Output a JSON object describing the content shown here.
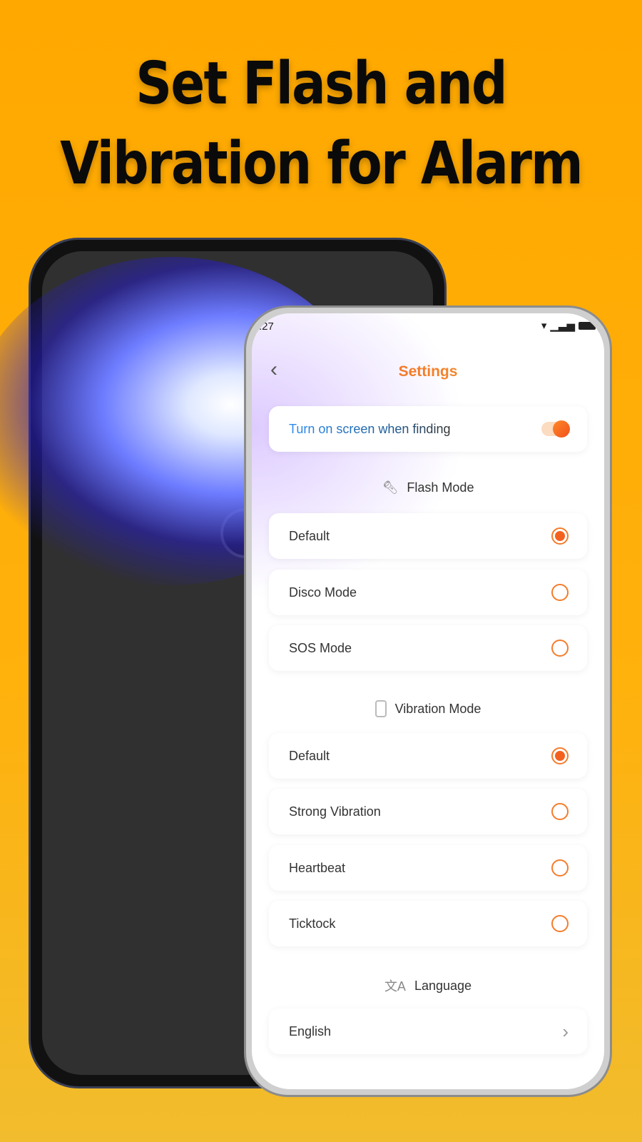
{
  "headline": {
    "line1": "Set Flash and",
    "line2": "Vibration for Alarm"
  },
  "status_bar": {
    "time": ":27"
  },
  "header": {
    "title": "Settings"
  },
  "screen_toggle": {
    "label": "Turn on screen when finding",
    "enabled": true
  },
  "flash_section": {
    "title": "Flash Mode",
    "icon": "flashlight-icon",
    "options": [
      {
        "label": "Default",
        "selected": true
      },
      {
        "label": "Disco Mode",
        "selected": false
      },
      {
        "label": "SOS Mode",
        "selected": false
      }
    ]
  },
  "vibration_section": {
    "title": "Vibration Mode",
    "icon": "phone-icon",
    "options": [
      {
        "label": "Default",
        "selected": true
      },
      {
        "label": "Strong Vibration",
        "selected": false
      },
      {
        "label": "Heartbeat",
        "selected": false
      },
      {
        "label": "Ticktock",
        "selected": false
      }
    ]
  },
  "language_section": {
    "title": "Language",
    "icon": "translate-icon",
    "value": "English"
  },
  "colors": {
    "accent": "#F4611E",
    "background": "#FFA800"
  }
}
